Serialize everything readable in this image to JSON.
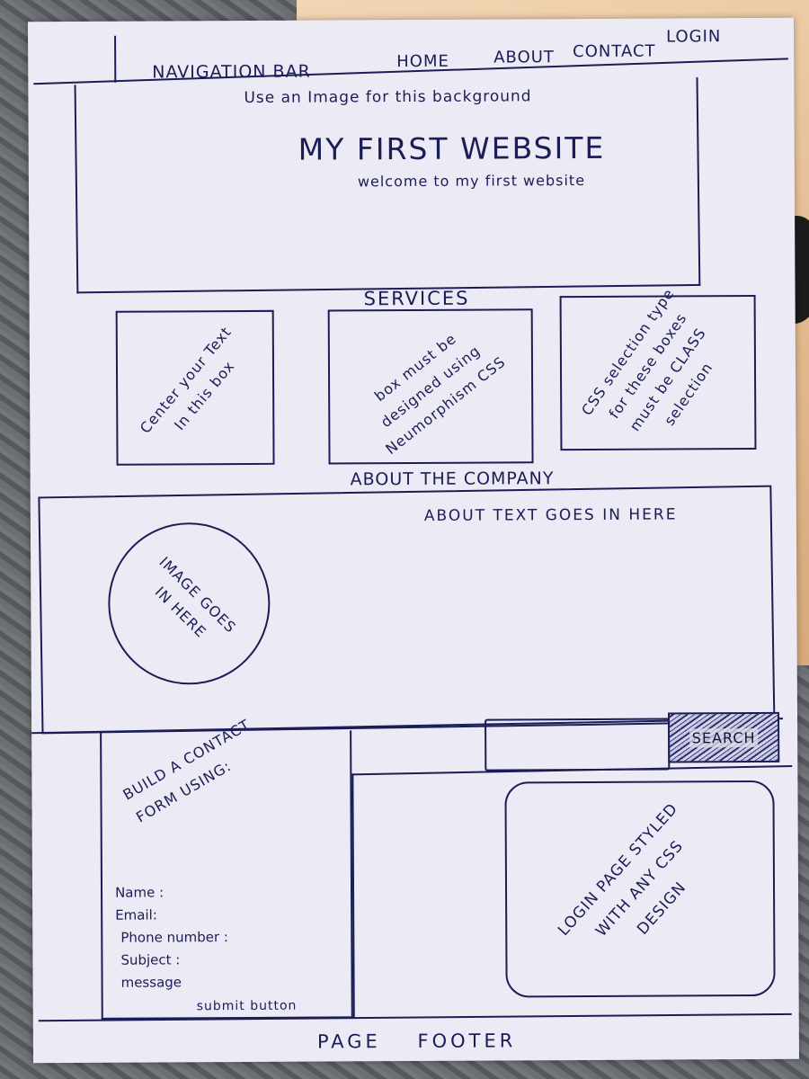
{
  "nav": {
    "title": "NAVIGATION BAR",
    "links": [
      "HOME",
      "ABOUT",
      "CONTACT",
      "LOGIN"
    ]
  },
  "hero": {
    "note": "Use an Image for this background",
    "title": "MY FIRST WEBSITE",
    "subtitle": "welcome to my first website"
  },
  "services": {
    "heading": "SERVICES",
    "boxes": [
      "Center your Text In this box",
      "box must be designed using Neumorphism CSS",
      "CSS selection type for these boxes must be CLASS selection"
    ]
  },
  "about": {
    "heading": "ABOUT THE COMPANY",
    "text": "ABOUT TEXT GOES IN HERE",
    "image_placeholder": "IMAGE GOES IN HERE"
  },
  "contact": {
    "title": "BUILD A CONTACT FORM USING:",
    "fields": [
      "Name :",
      "Email:",
      "Phone number :",
      "Subject :",
      "message"
    ],
    "submit": "submit button"
  },
  "search": {
    "button_label": "SEARCH"
  },
  "login": {
    "text": "LOGIN PAGE STYLED WITH ANY CSS DESIGN"
  },
  "footer": {
    "text": "PAGE FOOTER"
  },
  "colors": {
    "ink": "#1a1d56",
    "paper": "#eceaf4"
  }
}
